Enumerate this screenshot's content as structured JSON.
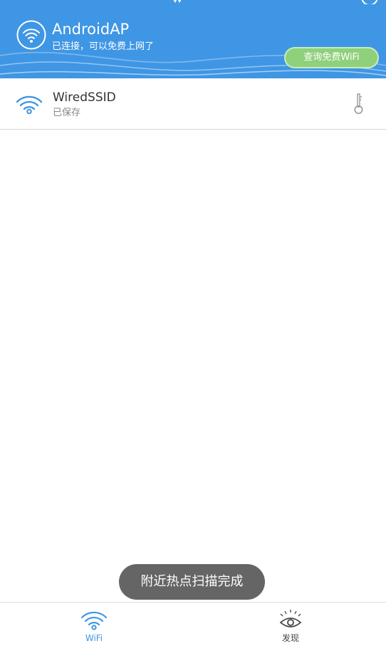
{
  "colors": {
    "header_bg": "#3f96e4",
    "query_button_bg": "#8fd07c",
    "toast_bg": "#656565",
    "active_tab": "#3f96e4"
  },
  "header": {
    "ap_name": "AndroidAP",
    "status": "已连接，可以免费上网了",
    "query_button": "查询免费WiFi",
    "icons": [
      "connected-wifi-icon",
      "top-antenna-icon",
      "settings-gear-icon"
    ]
  },
  "wifi_list": [
    {
      "ssid": "WiredSSID",
      "status": "已保存",
      "icon": "wifi-signal-icon",
      "trailing_icon": "key-icon"
    }
  ],
  "toast": {
    "message": "附近热点扫描完成"
  },
  "bottom_nav": [
    {
      "label": "WiFi",
      "icon": "wifi-icon",
      "active": true
    },
    {
      "label": "发现",
      "icon": "eye-icon",
      "active": false
    }
  ]
}
